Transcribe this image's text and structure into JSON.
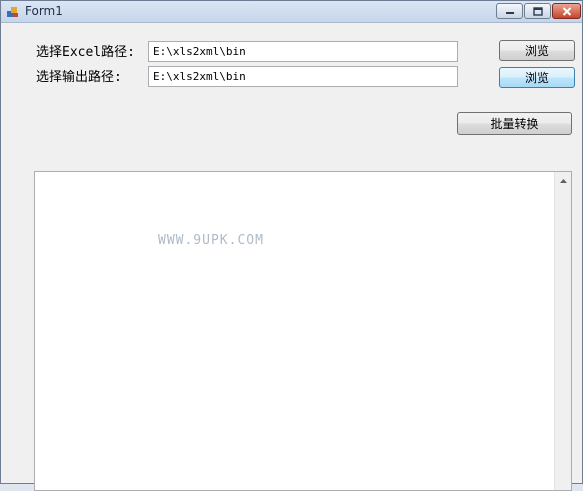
{
  "window": {
    "title": "Form1",
    "controls": {
      "minimize_icon": "minimize-icon",
      "maximize_icon": "maximize-icon",
      "close_icon": "close-icon"
    }
  },
  "form": {
    "excel_path_label": "选择Excel路径:",
    "excel_path_value": "E:\\xls2xml\\bin",
    "excel_browse_label": "浏览",
    "output_path_label": "选择输出路径:",
    "output_path_value": "E:\\xls2xml\\bin",
    "output_browse_label": "浏览",
    "batch_convert_label": "批量转换"
  },
  "log": {
    "watermark": "WWW.9UPK.COM"
  }
}
